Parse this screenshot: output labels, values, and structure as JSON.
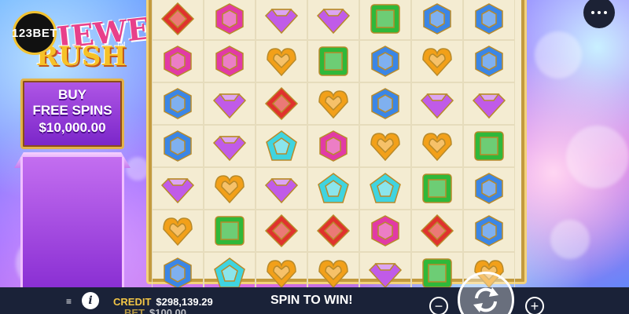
{
  "logo": {
    "brand": "123BET",
    "word1": "JEWEL",
    "word2": "RUSH",
    "tm": "TM"
  },
  "buy_panel": {
    "line1": "BUY",
    "line2": "FREE SPINS",
    "price": "$10,000.00"
  },
  "grid": {
    "rows": [
      [
        "red",
        "pink",
        "purple",
        "purple",
        "green",
        "blue",
        "blue"
      ],
      [
        "pink",
        "pink",
        "orange",
        "green",
        "blue",
        "orange",
        "blue"
      ],
      [
        "blue",
        "purple",
        "red",
        "orange",
        "blue",
        "purple",
        "purple"
      ],
      [
        "blue",
        "purple",
        "cyan",
        "pink",
        "orange",
        "orange",
        "green"
      ],
      [
        "purple",
        "orange",
        "purple",
        "cyan",
        "cyan",
        "green",
        "blue"
      ],
      [
        "orange",
        "green",
        "red",
        "red",
        "pink",
        "red",
        "blue"
      ],
      [
        "blue",
        "cyan",
        "orange",
        "orange",
        "purple",
        "green",
        "orange"
      ]
    ]
  },
  "colors": {
    "red": "#e0322d",
    "pink": "#e23aa6",
    "purple": "#c05be8",
    "green": "#2fb83a",
    "blue": "#3b86e6",
    "orange": "#f2a019",
    "cyan": "#3fd4e0"
  },
  "bottom": {
    "credit_label": "CREDIT",
    "credit_value": "$298,139.29",
    "bet_label": "BET",
    "bet_value": "$100.00",
    "message": "SPIN TO WIN!",
    "minus": "−",
    "plus": "+",
    "info": "i",
    "menu_glyph": "≡"
  },
  "icons": {
    "menu": "more-dots-icon",
    "spin": "spin-arrows-icon",
    "info": "info-icon",
    "hamburger": "hamburger-icon"
  }
}
